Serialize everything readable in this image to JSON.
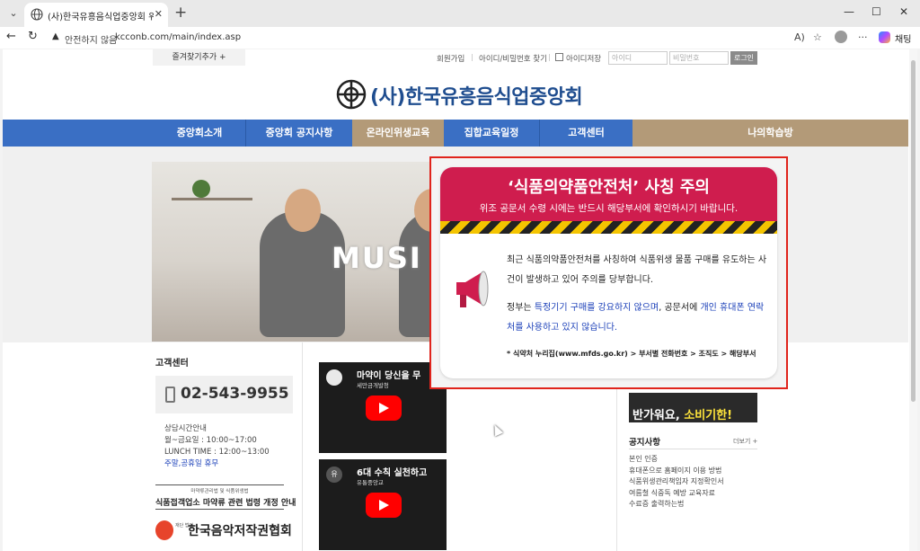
{
  "browser": {
    "tab_title": "(사)한국유흥음식업중앙회 위생교",
    "close_glyph": "✕",
    "new_tab_glyph": "+",
    "tab_list_glyph": "⌄",
    "win_minimize": "—",
    "win_maximize": "☐",
    "win_close": "✕",
    "back_glyph": "←",
    "reload_glyph": "↻",
    "warning_glyph": "▲",
    "insecure_label": "안전하지 않음",
    "url": "kcconb.com/main/index.asp",
    "read_aloud": "A)",
    "favorite_glyph": "☆",
    "more_glyph": "···",
    "chat_label": "채팅"
  },
  "topnav": {
    "favorites_add": "즐겨찾기추가 +",
    "signup": "회원가입",
    "sep": "|",
    "find_id_pw": "아이디/비밀번호 찾기",
    "save_id": "아이디저장",
    "id_placeholder": "아이디",
    "pw_placeholder": "비밀번호",
    "login": "로그인"
  },
  "logo": {
    "name": "(사)한국유흥음식업중앙회"
  },
  "menu": {
    "items": [
      {
        "label": "중앙회소개"
      },
      {
        "label": "중앙회 공지사항"
      },
      {
        "label": "온라인위생교육"
      },
      {
        "label": "집합교육일정"
      },
      {
        "label": "고객센터"
      },
      {
        "label": "나의학습방"
      }
    ]
  },
  "banner": {
    "text": "MUSI"
  },
  "popup": {
    "title": "‘식품의약품안전처’ 사칭 주의",
    "subtitle": "위조 공문서 수령 시에는 반드시 해당부서에 확인하시기 바랍니다.",
    "para1": "최근 식품의약품안전처를 사칭하여 식품위생 물품 구매를 유도하는 사건이 발생하고 있어 주의를 당부합니다.",
    "para2_a": "정부는 ",
    "para2_b": "특정기기 구매를 강요하지 않으며",
    "para2_c": ", 공문서에 ",
    "para2_d": "개인 휴대폰 연락처를 사용하고 있지 않습니다.",
    "footer": "* 식약처 누리집(www.mfds.go.kr) > 부서별 전화번호 > 조직도 > 해당부서"
  },
  "cs": {
    "title": "고객센터",
    "phone": "02-543-9955",
    "hours_title": "상담시간안내",
    "weekday": "월~금요일 : 10:00~17:00",
    "lunch": "LUNCH TIME : 12:00~13:00",
    "closed": "주말,공휴일 휴무"
  },
  "notice_banner": {
    "small": "마약류관리법 및 식품위생법",
    "big": "식품접객업소 마약류 관련 법령 개정 안내"
  },
  "kosa": {
    "small": "재단\n법인",
    "name": "한국음악저작권협회"
  },
  "videos": [
    {
      "title": "마약이 당신을 무",
      "sub": "세만금개발청"
    },
    {
      "title": "6대 수칙 실천하고",
      "sub": "유통중앙교",
      "ch": "유"
    }
  ],
  "right_banner": {
    "text_a": "반가워요, ",
    "text_b": "소비기한!"
  },
  "notices": {
    "title": "공지사항",
    "more": "더보기 +",
    "items": [
      "본인 인증",
      "휴대폰으로 홈페이지 이용 방법",
      "식품위생관리책임자 지정확인서",
      "여름철 식중독 예방 교육자료",
      "수료증 출력하는법"
    ]
  },
  "colors": {
    "menu_blue": "#3a6fc4",
    "menu_brown": "#b39a78",
    "popup_red": "#cf1d4e",
    "popup_border": "#e0241c",
    "logo_blue": "#1f4d8f"
  }
}
